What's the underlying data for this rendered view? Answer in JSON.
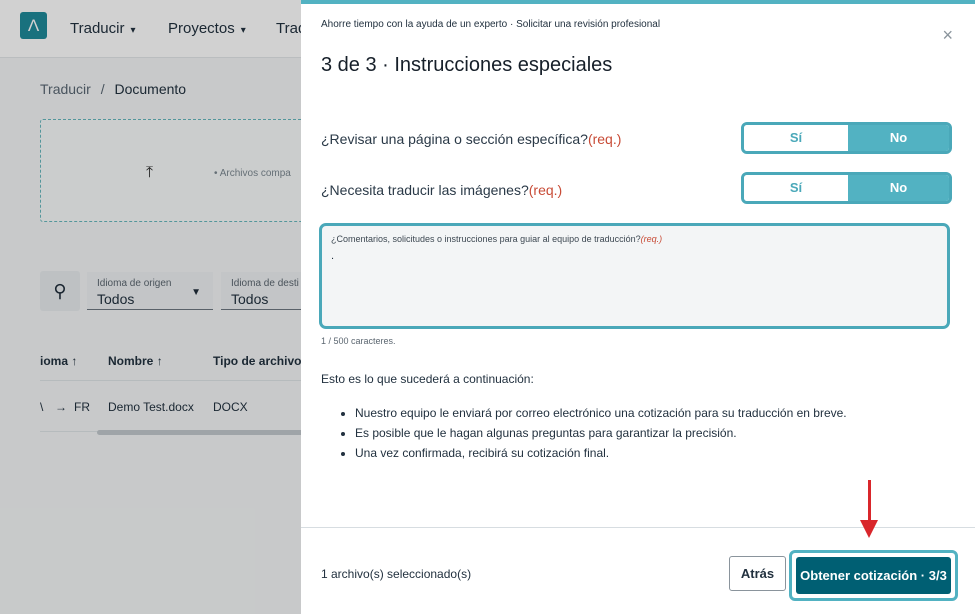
{
  "background": {
    "nav": [
      {
        "label": "Traducir"
      },
      {
        "label": "Proyectos"
      },
      {
        "label": "Trad"
      }
    ],
    "breadcrumb": {
      "parent": "Traducir",
      "separator": "/",
      "current": "Documento"
    },
    "upload_hint": "Archivos compa",
    "filters": {
      "source": {
        "label": "Idioma de origen",
        "value": "Todos"
      },
      "target": {
        "label": "Idioma de desti",
        "value": "Todos"
      }
    },
    "table": {
      "headers": [
        "ioma",
        "Nombre",
        "Tipo de archivo"
      ],
      "row": {
        "lang_from": "\\",
        "lang_to": "FR",
        "name": "Demo Test.docx",
        "type": "DOCX"
      }
    }
  },
  "modal": {
    "subtitle": "Ahorre tiempo con la ayuda de un experto · Solicitar una revisión profesional",
    "title": "3 de 3 · Instrucciones especiales",
    "close_symbol": "×",
    "questions": [
      {
        "label": "¿Revisar una página o sección específica?",
        "req": "(req.)",
        "yes": "Sí",
        "no": "No",
        "selected": "No"
      },
      {
        "label": "¿Necesita traducir las imágenes?",
        "req": "(req.)",
        "yes": "Sí",
        "no": "No",
        "selected": "No"
      }
    ],
    "comment": {
      "label": "¿Comentarios, solicitudes o instrucciones para guiar al equipo de traducción?",
      "req": "(req.)",
      "value": ".",
      "char_count": "1 / 500 caracteres."
    },
    "next_steps": {
      "title": "Esto es lo que sucederá a continuación:",
      "items": [
        "Nuestro equipo le enviará por correo electrónico una cotización para su traducción en breve.",
        "Es posible que le hagan algunas preguntas para garantizar la precisión.",
        "Una vez confirmada, recibirá su cotización final."
      ]
    },
    "footer": {
      "selected": "1 archivo(s) seleccionado(s)",
      "back": "Atrás",
      "quote": "Obtener cotización · 3/3"
    }
  },
  "colors": {
    "accent": "#52b2c2",
    "primary_button": "#005f73",
    "required": "#c84b36",
    "annotation_arrow": "#d9262b"
  }
}
